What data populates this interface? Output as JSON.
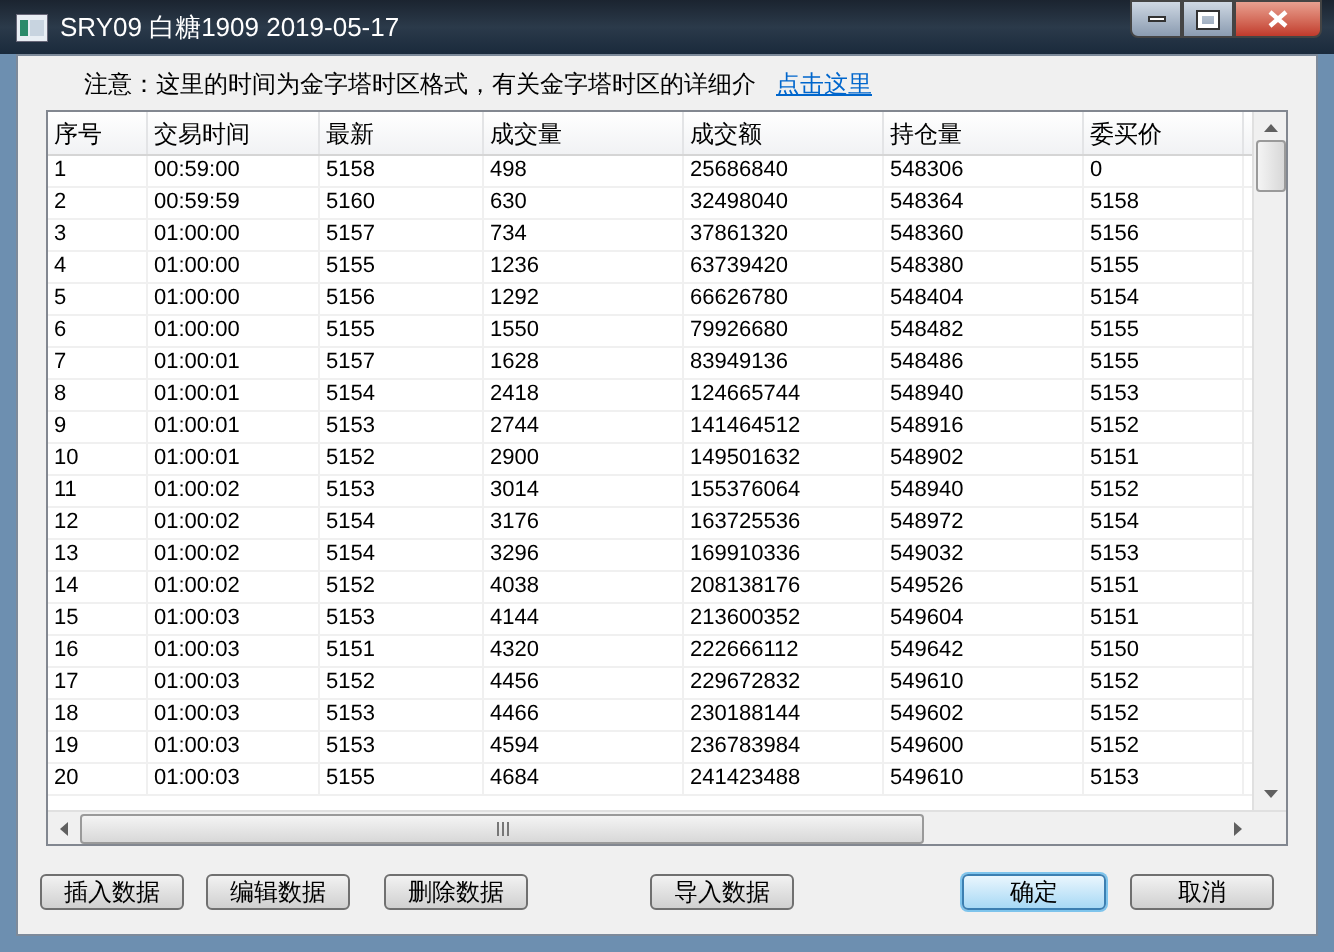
{
  "window": {
    "title": "SRY09 白糖1909 2019-05-17"
  },
  "notice": {
    "text": "注意：这里的时间为金字塔时区格式，有关金字塔时区的详细介",
    "link": "点击这里"
  },
  "table": {
    "columns": [
      "序号",
      "交易时间",
      "最新",
      "成交量",
      "成交额",
      "持仓量",
      "委买价"
    ],
    "rows": [
      [
        "1",
        "00:59:00",
        "5158",
        "498",
        "25686840",
        "548306",
        "0"
      ],
      [
        "2",
        "00:59:59",
        "5160",
        "630",
        "32498040",
        "548364",
        "5158"
      ],
      [
        "3",
        "01:00:00",
        "5157",
        "734",
        "37861320",
        "548360",
        "5156"
      ],
      [
        "4",
        "01:00:00",
        "5155",
        "1236",
        "63739420",
        "548380",
        "5155"
      ],
      [
        "5",
        "01:00:00",
        "5156",
        "1292",
        "66626780",
        "548404",
        "5154"
      ],
      [
        "6",
        "01:00:00",
        "5155",
        "1550",
        "79926680",
        "548482",
        "5155"
      ],
      [
        "7",
        "01:00:01",
        "5157",
        "1628",
        "83949136",
        "548486",
        "5155"
      ],
      [
        "8",
        "01:00:01",
        "5154",
        "2418",
        "124665744",
        "548940",
        "5153"
      ],
      [
        "9",
        "01:00:01",
        "5153",
        "2744",
        "141464512",
        "548916",
        "5152"
      ],
      [
        "10",
        "01:00:01",
        "5152",
        "2900",
        "149501632",
        "548902",
        "5151"
      ],
      [
        "11",
        "01:00:02",
        "5153",
        "3014",
        "155376064",
        "548940",
        "5152"
      ],
      [
        "12",
        "01:00:02",
        "5154",
        "3176",
        "163725536",
        "548972",
        "5154"
      ],
      [
        "13",
        "01:00:02",
        "5154",
        "3296",
        "169910336",
        "549032",
        "5153"
      ],
      [
        "14",
        "01:00:02",
        "5152",
        "4038",
        "208138176",
        "549526",
        "5151"
      ],
      [
        "15",
        "01:00:03",
        "5153",
        "4144",
        "213600352",
        "549604",
        "5151"
      ],
      [
        "16",
        "01:00:03",
        "5151",
        "4320",
        "222666112",
        "549642",
        "5150"
      ],
      [
        "17",
        "01:00:03",
        "5152",
        "4456",
        "229672832",
        "549610",
        "5152"
      ],
      [
        "18",
        "01:00:03",
        "5153",
        "4466",
        "230188144",
        "549602",
        "5152"
      ],
      [
        "19",
        "01:00:03",
        "5153",
        "4594",
        "236783984",
        "549600",
        "5152"
      ],
      [
        "20",
        "01:00:03",
        "5155",
        "4684",
        "241423488",
        "549610",
        "5153"
      ]
    ]
  },
  "buttons": [
    {
      "label": "插入数据",
      "kind": "normal"
    },
    {
      "label": "编辑数据",
      "kind": "normal"
    },
    {
      "label": "删除数据",
      "kind": "normal"
    },
    {
      "label": "导入数据",
      "kind": "normal"
    },
    {
      "label": "确定",
      "kind": "default"
    },
    {
      "label": "取消",
      "kind": "normal"
    }
  ]
}
